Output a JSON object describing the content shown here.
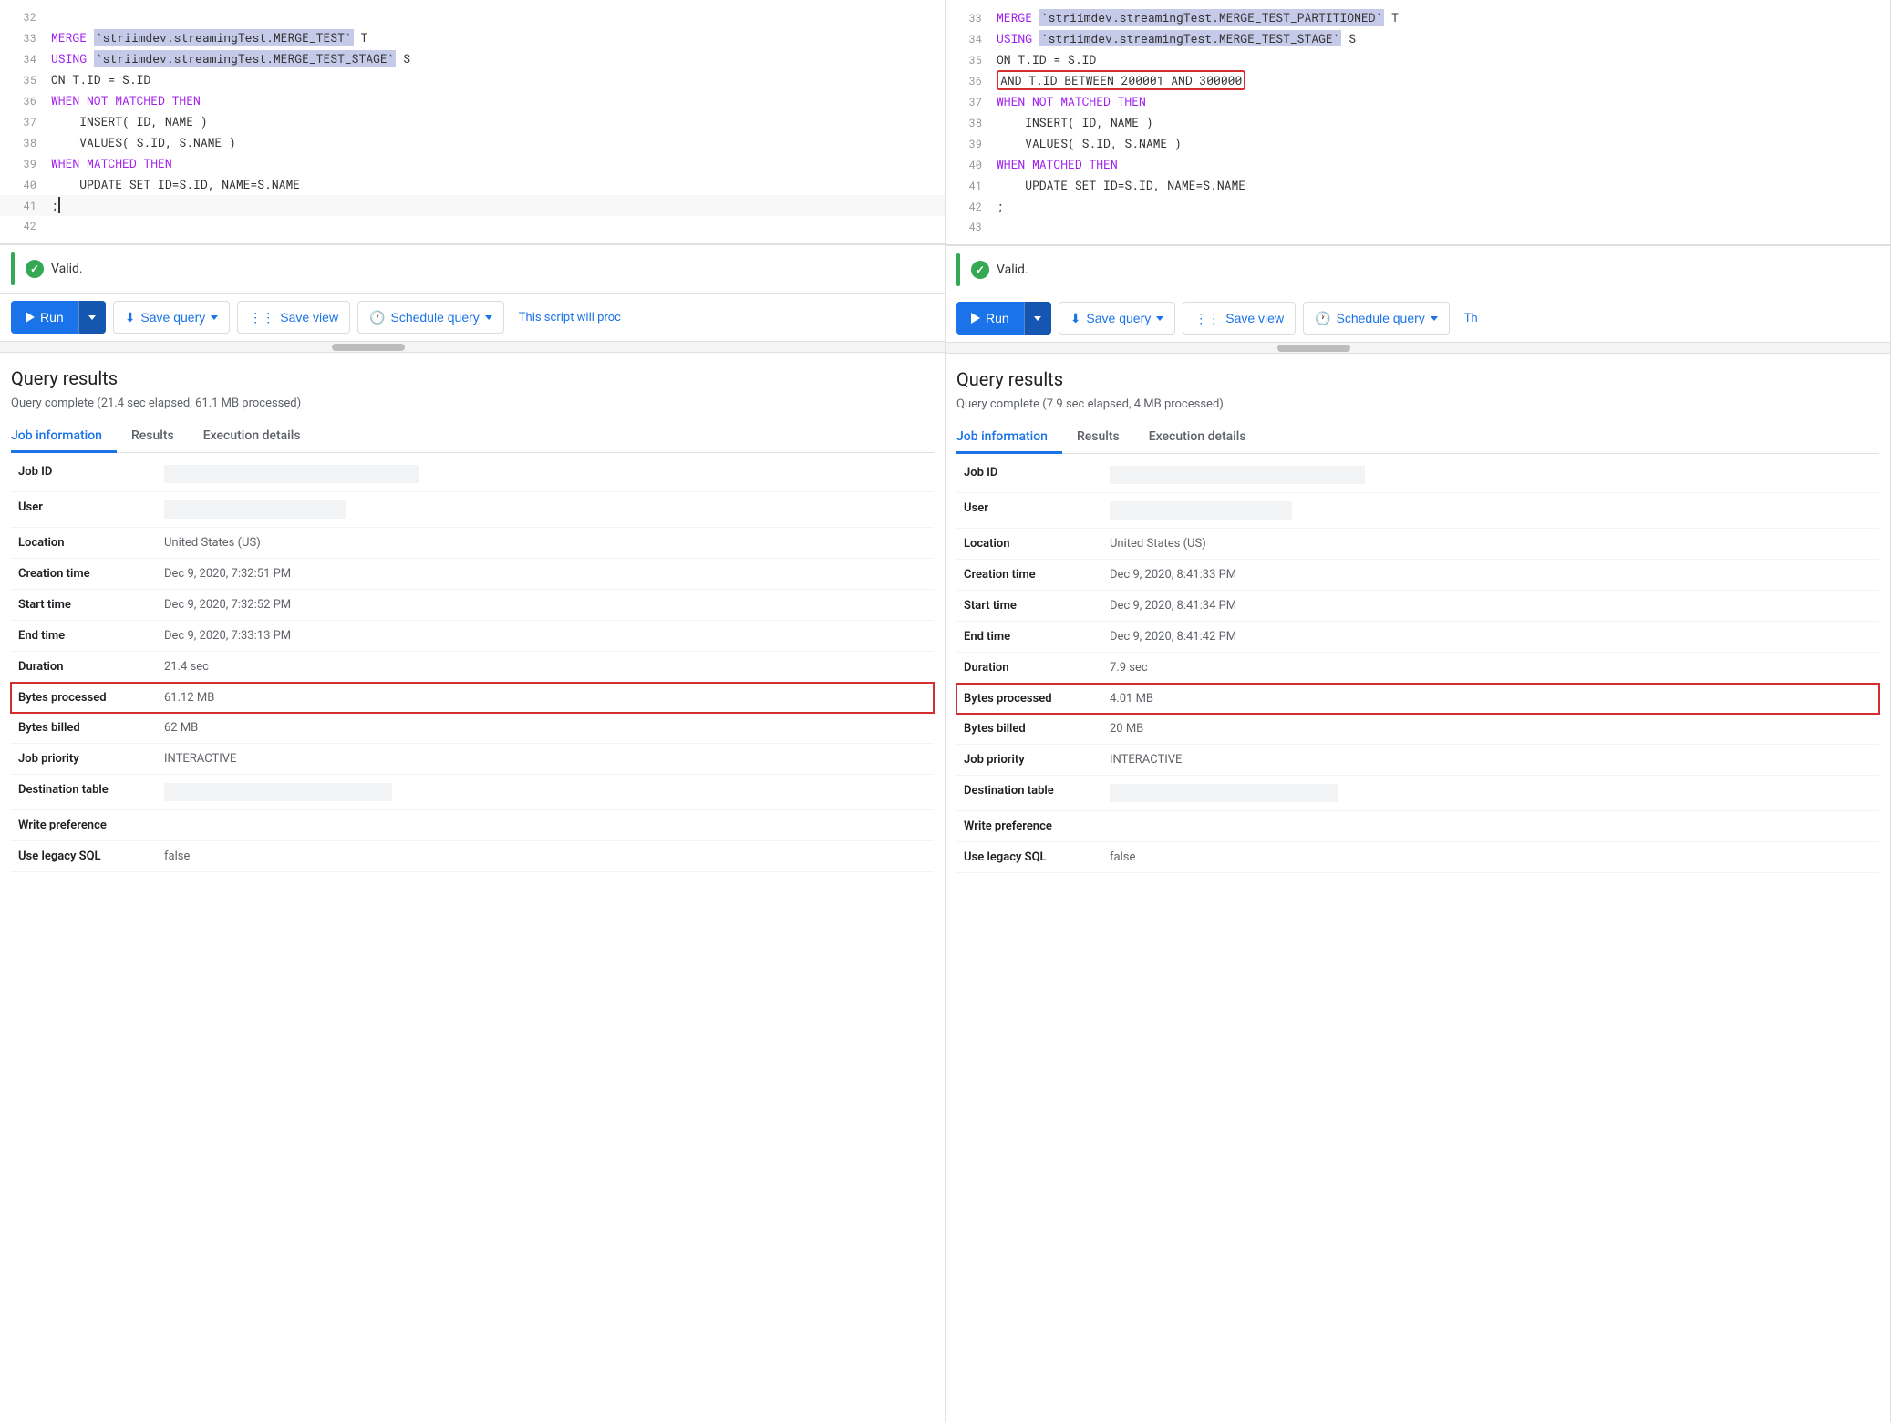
{
  "colors": {
    "blue": "#1a73e8",
    "green": "#34a853",
    "red": "#d32f2f",
    "gray_text": "#5f6368",
    "dark_text": "#202124",
    "highlight_bg": "#c5cae9"
  },
  "left_panel": {
    "code_lines": [
      {
        "num": "32",
        "content": ""
      },
      {
        "num": "33",
        "parts": [
          {
            "text": "MERGE ",
            "class": "kw-purple"
          },
          {
            "text": "`striimdev.streamingTest.MERGE_TEST`",
            "class": "tbl-name"
          },
          {
            "text": " T",
            "class": ""
          }
        ]
      },
      {
        "num": "34",
        "parts": [
          {
            "text": "USING ",
            "class": "kw-purple"
          },
          {
            "text": "`striimdev.streamingTest.MERGE_TEST_STAGE`",
            "class": "tbl-name"
          },
          {
            "text": " S",
            "class": ""
          }
        ]
      },
      {
        "num": "35",
        "parts": [
          {
            "text": "ON T.ID = S.ID",
            "class": ""
          }
        ]
      },
      {
        "num": "36",
        "parts": [
          {
            "text": "WHEN NOT MATCHED THEN",
            "class": "kw-purple"
          }
        ]
      },
      {
        "num": "37",
        "parts": [
          {
            "text": "    INSERT( ID, NAME )",
            "class": ""
          }
        ]
      },
      {
        "num": "38",
        "parts": [
          {
            "text": "    VALUES( S.ID, S.NAME )",
            "class": ""
          }
        ]
      },
      {
        "num": "39",
        "parts": [
          {
            "text": "WHEN MATCHED THEN",
            "class": "kw-purple"
          }
        ]
      },
      {
        "num": "40",
        "parts": [
          {
            "text": "    UPDATE SET ID=S.ID, NAME=S.NAME",
            "class": ""
          }
        ]
      },
      {
        "num": "41",
        "parts": [
          {
            "text": ";|",
            "class": "cursor-char"
          }
        ]
      },
      {
        "num": "42",
        "content": ""
      }
    ],
    "valid_text": "Valid.",
    "toolbar": {
      "run_label": "Run",
      "save_query_label": "Save query",
      "save_view_label": "Save view",
      "schedule_query_label": "Schedule query"
    },
    "script_notice": "This script will proc",
    "results": {
      "title": "Query results",
      "stats": "Query complete (21.4 sec elapsed, 61.1 MB processed)",
      "tabs": [
        "Job information",
        "Results",
        "Execution details"
      ],
      "active_tab": "Job information",
      "fields": [
        {
          "label": "Job ID",
          "value": "",
          "type": "redacted"
        },
        {
          "label": "User",
          "value": "",
          "type": "redacted_small"
        },
        {
          "label": "Location",
          "value": "United States (US)"
        },
        {
          "label": "Creation time",
          "value": "Dec 9, 2020, 7:32:51 PM"
        },
        {
          "label": "Start time",
          "value": "Dec 9, 2020, 7:32:52 PM"
        },
        {
          "label": "End time",
          "value": "Dec 9, 2020, 7:33:13 PM"
        },
        {
          "label": "Duration",
          "value": "21.4 sec"
        },
        {
          "label": "Bytes processed",
          "value": "61.12 MB",
          "highlight": true
        },
        {
          "label": "Bytes billed",
          "value": "62 MB"
        },
        {
          "label": "Job priority",
          "value": "INTERACTIVE"
        },
        {
          "label": "Destination table",
          "value": "",
          "type": "redacted"
        },
        {
          "label": "Write preference",
          "value": ""
        },
        {
          "label": "Use legacy SQL",
          "value": "false"
        }
      ]
    }
  },
  "right_panel": {
    "code_lines": [
      {
        "num": "33",
        "parts": [
          {
            "text": "MERGE ",
            "class": "kw-purple"
          },
          {
            "text": "`striimdev.streamingTest.MERGE_TEST_PARTITIONED`",
            "class": "tbl-name"
          },
          {
            "text": " T",
            "class": ""
          }
        ]
      },
      {
        "num": "34",
        "parts": [
          {
            "text": "USING ",
            "class": "kw-purple"
          },
          {
            "text": "`striimdev.streamingTest.MERGE_TEST_STAGE`",
            "class": "tbl-name"
          },
          {
            "text": " S",
            "class": ""
          }
        ]
      },
      {
        "num": "35",
        "parts": [
          {
            "text": "ON T.ID = S.ID",
            "class": ""
          }
        ]
      },
      {
        "num": "36",
        "parts": [
          {
            "text": "AND T.ID BETWEEN 200001 AND 300000",
            "class": "",
            "highlight_box": true
          }
        ]
      },
      {
        "num": "37",
        "parts": [
          {
            "text": "WHEN NOT MATCHED THEN",
            "class": "kw-purple"
          }
        ]
      },
      {
        "num": "38",
        "parts": [
          {
            "text": "    INSERT( ID, NAME )",
            "class": ""
          }
        ]
      },
      {
        "num": "39",
        "parts": [
          {
            "text": "    VALUES( S.ID, S.NAME )",
            "class": ""
          }
        ]
      },
      {
        "num": "40",
        "parts": [
          {
            "text": "WHEN MATCHED THEN",
            "class": "kw-purple"
          }
        ]
      },
      {
        "num": "41",
        "parts": [
          {
            "text": "    UPDATE SET ID=S.ID, NAME=S.NAME",
            "class": ""
          }
        ]
      },
      {
        "num": "42",
        "parts": [
          {
            "text": ";",
            "class": ""
          }
        ]
      },
      {
        "num": "43",
        "content": ""
      }
    ],
    "valid_text": "Valid.",
    "toolbar": {
      "run_label": "Run",
      "save_query_label": "Save query",
      "save_view_label": "Save view",
      "schedule_query_label": "Schedule query"
    },
    "script_notice": "Th",
    "results": {
      "title": "Query results",
      "stats": "Query complete (7.9 sec elapsed, 4 MB processed)",
      "tabs": [
        "Job information",
        "Results",
        "Execution details"
      ],
      "active_tab": "Job information",
      "fields": [
        {
          "label": "Job ID",
          "value": "",
          "type": "redacted"
        },
        {
          "label": "User",
          "value": "",
          "type": "redacted_small"
        },
        {
          "label": "Location",
          "value": "United States (US)"
        },
        {
          "label": "Creation time",
          "value": "Dec 9, 2020, 8:41:33 PM"
        },
        {
          "label": "Start time",
          "value": "Dec 9, 2020, 8:41:34 PM"
        },
        {
          "label": "End time",
          "value": "Dec 9, 2020, 8:41:42 PM"
        },
        {
          "label": "Duration",
          "value": "7.9 sec"
        },
        {
          "label": "Bytes processed",
          "value": "4.01 MB",
          "highlight": true
        },
        {
          "label": "Bytes billed",
          "value": "20 MB"
        },
        {
          "label": "Job priority",
          "value": "INTERACTIVE"
        },
        {
          "label": "Destination table",
          "value": "",
          "type": "redacted"
        },
        {
          "label": "Write preference",
          "value": ""
        },
        {
          "label": "Use legacy SQL",
          "value": "false"
        }
      ]
    }
  }
}
